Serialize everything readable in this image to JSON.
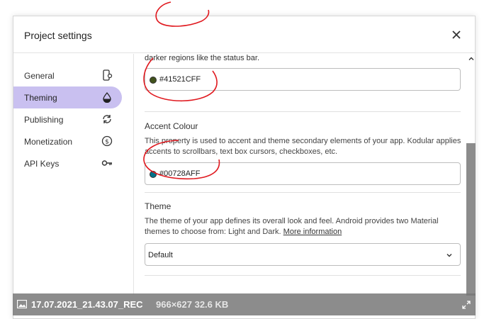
{
  "dialog": {
    "title": "Project settings",
    "close_icon": "close-icon"
  },
  "sidebar": {
    "items": [
      {
        "label": "General",
        "icon": "phone-settings-icon"
      },
      {
        "label": "Theming",
        "icon": "droplet-icon",
        "active": true
      },
      {
        "label": "Publishing",
        "icon": "sync-icon"
      },
      {
        "label": "Monetization",
        "icon": "dollar-circle-icon"
      },
      {
        "label": "API Keys",
        "icon": "key-icon"
      }
    ]
  },
  "content": {
    "primary_dark_fragment": "darker regions like the status bar.",
    "primary_dark_value": "#41521CFF",
    "accent_title": "Accent Colour",
    "accent_desc": "This property is used to accent and theme secondary elements of your app. Kodular applies accents to scrollbars, text box cursors, checkboxes, etc.",
    "accent_value": "#00728AFF",
    "theme_title": "Theme",
    "theme_desc": "The theme of your app defines its overall look and feel. Android provides two Material themes to choose from: Light and Dark.",
    "theme_link": "More information",
    "theme_selected": "Default"
  },
  "colors": {
    "primary_dark_swatch": "#41521C",
    "accent_swatch": "#00728A",
    "active_nav": "#c9c0f0",
    "annotation": "#e0191f"
  },
  "caption": {
    "filename": "17.07.2021_21.43.07_REC",
    "meta": "966×627 32.6 KB"
  }
}
